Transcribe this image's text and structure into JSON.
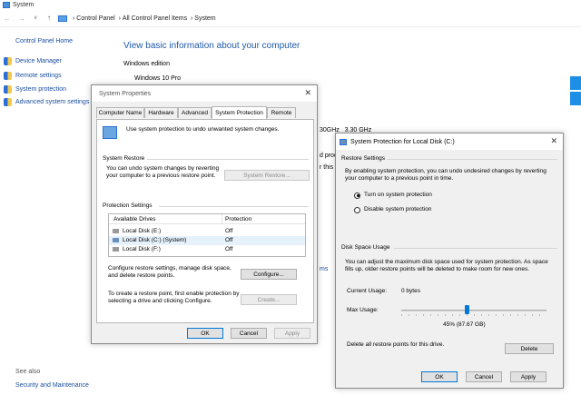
{
  "system_window": {
    "title": "System",
    "address_path": [
      "Control Panel",
      "All Control Panel Items",
      "System"
    ],
    "sidebar": {
      "home": "Control Panel Home",
      "items": [
        "Device Manager",
        "Remote settings",
        "System protection",
        "Advanced system settings"
      ],
      "see_also_label": "See also",
      "see_also_items": [
        "Security and Maintenance"
      ]
    },
    "main": {
      "heading": "View basic information about your computer",
      "windows_edition_label": "Windows edition",
      "edition": "Windows 10 Pro",
      "cpu_fragment": "30GHz   3.30 GHz",
      "partial_text_1": "d proc",
      "partial_text_2": "r this",
      "partial_link": "ms"
    }
  },
  "system_properties": {
    "title": "System Properties",
    "tabs": [
      "Computer Name",
      "Hardware",
      "Advanced",
      "System Protection",
      "Remote"
    ],
    "active_tab": "System Protection",
    "intro": "Use system protection to undo unwanted system changes.",
    "restore_group": "System Restore",
    "restore_text": "You can undo system changes by reverting your computer to a previous restore point.",
    "restore_button": "System Restore...",
    "protection_group": "Protection Settings",
    "columns": [
      "Available Drives",
      "Protection"
    ],
    "drives": [
      {
        "name": "Local Disk (E:)",
        "protection": "Off"
      },
      {
        "name": "Local Disk (C:) (System)",
        "protection": "Off"
      },
      {
        "name": "Local Disk (F:)",
        "protection": "Off"
      }
    ],
    "configure_text": "Configure restore settings, manage disk space, and delete restore points.",
    "configure_button": "Configure...",
    "create_text": "To create a restore point, first enable protection by selecting a drive and clicking Configure.",
    "create_button": "Create...",
    "ok": "OK",
    "cancel": "Cancel",
    "apply": "Apply"
  },
  "protection_dialog": {
    "title": "System Protection for Local Disk (C:)",
    "restore_settings_label": "Restore Settings",
    "restore_settings_text": "By enabling system protection, you can undo undesired changes by reverting your computer to a previous point in time.",
    "option_on": "Turn on system protection",
    "option_off": "Disable system protection",
    "selected_option": "on",
    "disk_space_label": "Disk Space Usage",
    "disk_space_text": "You can adjust the maximum disk space used for system protection. As space fills up, older restore points will be deleted to make room for new ones.",
    "current_usage_label": "Current Usage:",
    "current_usage_value": "0 bytes",
    "max_usage_label": "Max Usage:",
    "max_usage_percent": 45,
    "max_usage_text": "45% (87.67 GB)",
    "delete_text": "Delete all restore points for this drive.",
    "delete_button": "Delete",
    "ok": "OK",
    "cancel": "Cancel",
    "apply": "Apply"
  },
  "colors": {
    "link": "#1a4ea1",
    "heading": "#1e5aa8",
    "accent": "#0078d7"
  }
}
